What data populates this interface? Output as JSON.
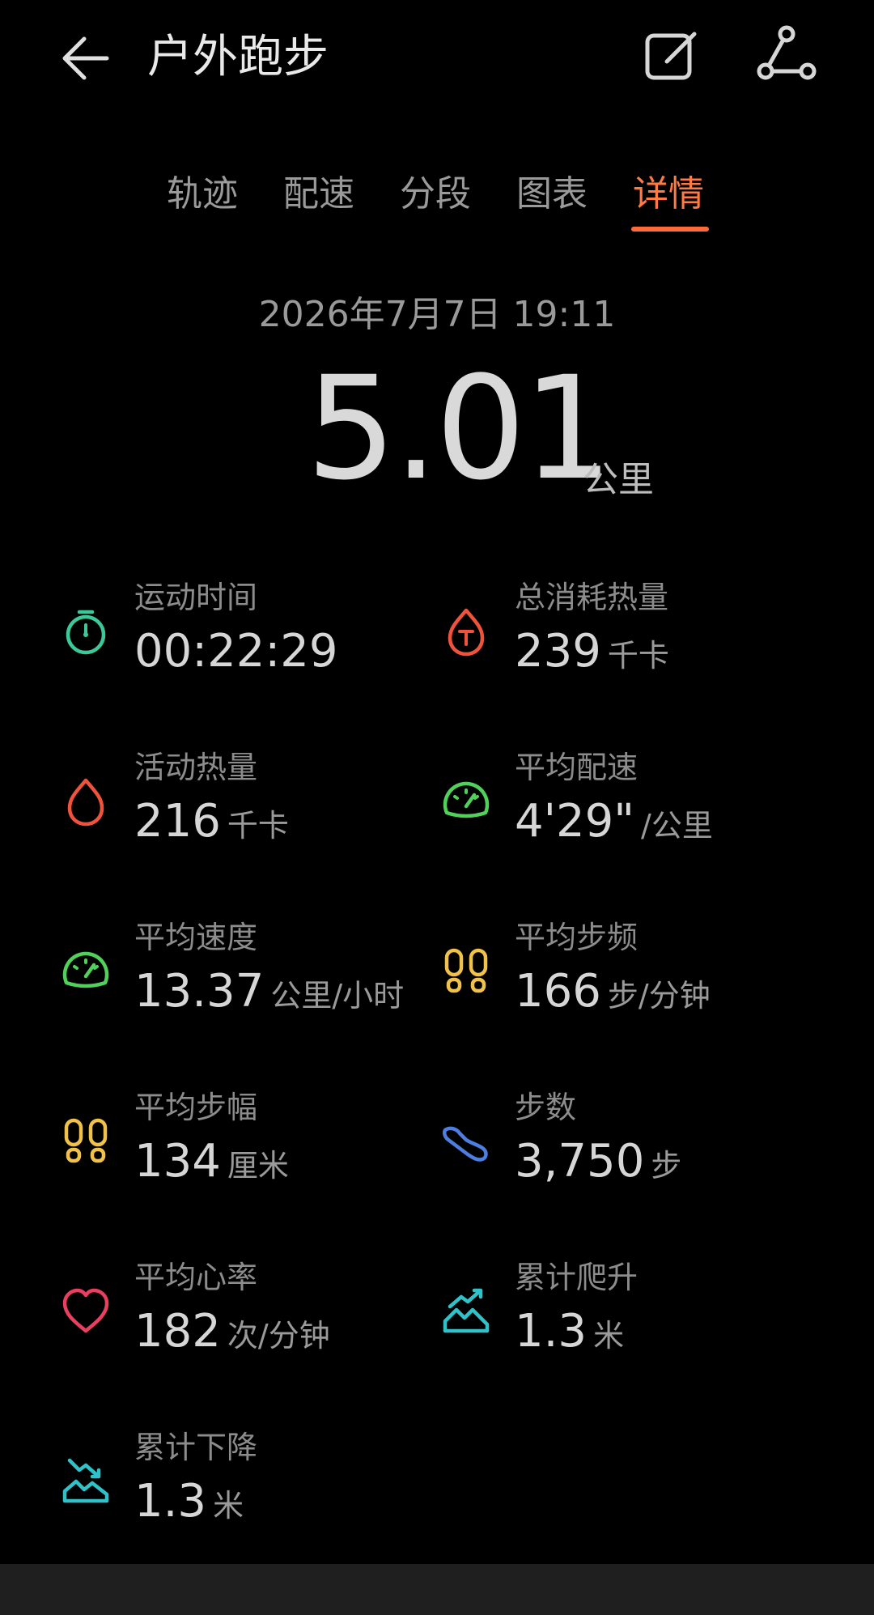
{
  "header": {
    "title": "户外跑步"
  },
  "tabs": [
    {
      "label": "轨迹"
    },
    {
      "label": "配速"
    },
    {
      "label": "分段"
    },
    {
      "label": "图表"
    },
    {
      "label": "详情",
      "active": true
    }
  ],
  "summary": {
    "datetime": "2026年7月7日 19:11",
    "distance": "5.01",
    "distance_unit": "公里"
  },
  "stats": [
    {
      "label": "运动时间",
      "value": "00:22:29",
      "unit": "",
      "icon": "stopwatch-icon",
      "color": "#3cc99a"
    },
    {
      "label": "总消耗热量",
      "value": "239",
      "unit": "千卡",
      "icon": "flame-total-icon",
      "color": "#f0533c"
    },
    {
      "label": "活动热量",
      "value": "216",
      "unit": "千卡",
      "icon": "flame-icon",
      "color": "#f0533c"
    },
    {
      "label": "平均配速",
      "value": "4'29\"",
      "unit": "/公里",
      "icon": "speedometer-icon",
      "color": "#4fd15a"
    },
    {
      "label": "平均速度",
      "value": "13.37",
      "unit": "公里/小时",
      "icon": "speedometer-icon",
      "color": "#4fd15a"
    },
    {
      "label": "平均步频",
      "value": "166",
      "unit": "步/分钟",
      "icon": "footprints-icon",
      "color": "#f1c24a"
    },
    {
      "label": "平均步幅",
      "value": "134",
      "unit": "厘米",
      "icon": "footprints-icon",
      "color": "#f1c24a"
    },
    {
      "label": "步数",
      "value": "3,750",
      "unit": "步",
      "icon": "shoe-icon",
      "color": "#4d7fe0"
    },
    {
      "label": "平均心率",
      "value": "182",
      "unit": "次/分钟",
      "icon": "heart-icon",
      "color": "#ea3f5f"
    },
    {
      "label": "累计爬升",
      "value": "1.3",
      "unit": "米",
      "icon": "climb-icon",
      "color": "#2fc2c9"
    },
    {
      "label": "累计下降",
      "value": "1.3",
      "unit": "米",
      "icon": "descent-icon",
      "color": "#2fc2c9"
    }
  ]
}
